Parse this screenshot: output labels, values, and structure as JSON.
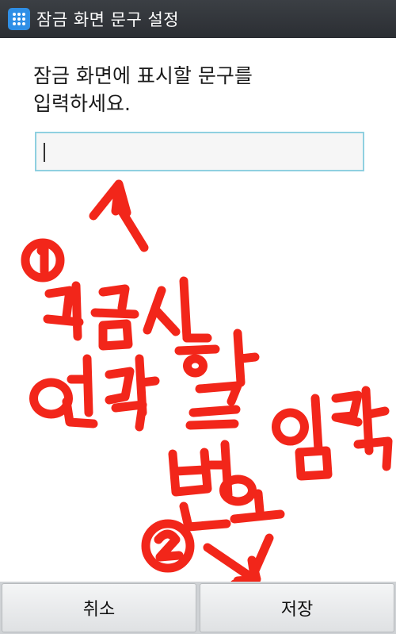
{
  "titlebar": {
    "title": "잠금 화면 문구 설정",
    "icon": "grid-app-icon"
  },
  "main": {
    "instruction": "잠금 화면에 표시할 문구를\n입력하세요.",
    "input": {
      "value": "",
      "placeholder": ""
    }
  },
  "annotation": {
    "color": "#f2261a",
    "step1_marker": "①",
    "step1_text_line1": "긴급시",
    "step1_text_line2": "연락할",
    "step1_text_line3": "번호입력",
    "step2_marker": "②"
  },
  "buttons": {
    "cancel_label": "취소",
    "save_label": "저장"
  }
}
